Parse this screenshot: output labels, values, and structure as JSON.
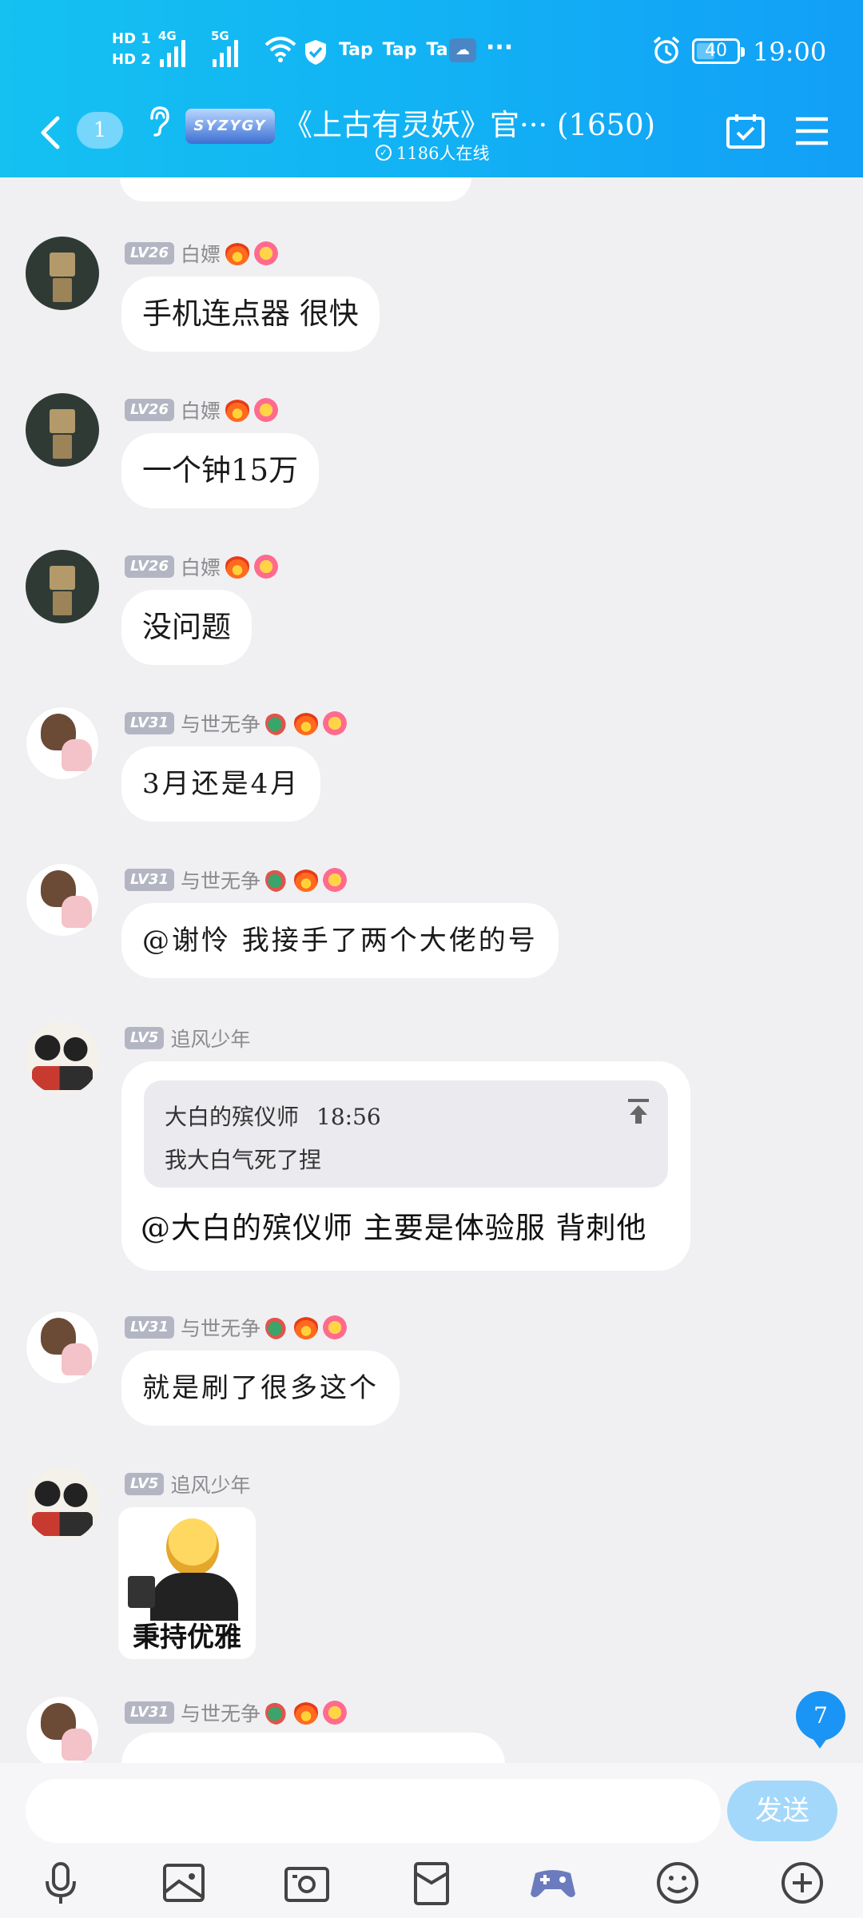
{
  "status_bar": {
    "hd1": "HD 1",
    "hd2": "HD 2",
    "net1": "4G",
    "net2": "5G",
    "taps": [
      "Tap",
      "Tap",
      "Tap"
    ],
    "more": "···",
    "battery": "40",
    "time": "19:00"
  },
  "header": {
    "unread_count": "1",
    "game_logo": "SYZYGY",
    "title": "《上古有灵妖》官··· (1650)",
    "online": "1186人在线",
    "online_icon": "✓"
  },
  "messages": [
    {
      "level": "LV26",
      "name": "白嫖",
      "avatar": "box",
      "text": "手机连点器 很快"
    },
    {
      "level": "LV26",
      "name": "白嫖",
      "avatar": "box",
      "text": "一个钟15万"
    },
    {
      "level": "LV26",
      "name": "白嫖",
      "avatar": "box",
      "text": "没问题"
    },
    {
      "level": "LV31",
      "name": "与世无争",
      "avatar": "girl",
      "text": "3月还是4月"
    },
    {
      "level": "LV31",
      "name": "与世无争",
      "avatar": "girl",
      "text": "@谢怜 我接手了两个大佬的号"
    },
    {
      "level": "LV5",
      "name": "追风少年",
      "avatar": "group",
      "quote": {
        "name": "大白的殡仪师",
        "time": "18:56",
        "text": "我大白气死了捏"
      },
      "text": "@大白的殡仪师 主要是体验服 背刺他"
    },
    {
      "level": "LV31",
      "name": "与世无争",
      "avatar": "girl",
      "text": "就是刷了很多这个"
    },
    {
      "level": "LV5",
      "name": "追风少年",
      "avatar": "group",
      "sticker_caption": "秉持优雅"
    },
    {
      "level": "LV31",
      "name": "与世无争",
      "avatar": "girl"
    }
  ],
  "new_message_count": "7",
  "composer": {
    "placeholder": "",
    "send_label": "发送"
  },
  "toolbar": [
    "mic-icon",
    "image-icon",
    "camera-icon",
    "red-packet-icon",
    "gamepad-icon",
    "emoji-icon",
    "plus-icon"
  ]
}
